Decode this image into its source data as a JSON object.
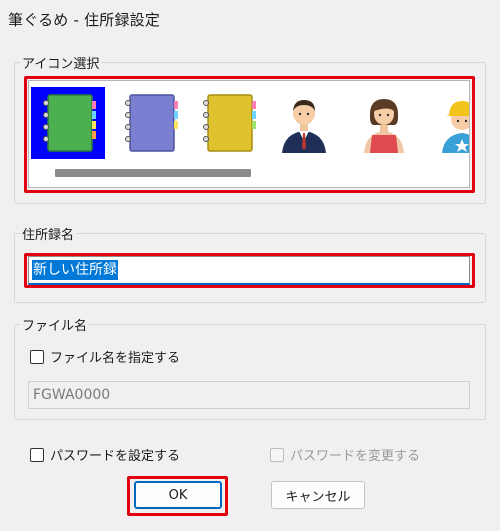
{
  "window": {
    "title": "筆ぐるめ - 住所録設定"
  },
  "icon_section": {
    "label": "アイコン選択",
    "icons": [
      {
        "name": "green-notebook-icon",
        "color": "#4caf50",
        "selected": true
      },
      {
        "name": "purple-notebook-icon",
        "color": "#7b7fd1",
        "selected": false
      },
      {
        "name": "yellow-notebook-icon",
        "color": "#e0c22e",
        "selected": false
      },
      {
        "name": "businessman-icon",
        "selected": false
      },
      {
        "name": "woman-apron-icon",
        "selected": false
      },
      {
        "name": "child-helmet-icon",
        "selected": false
      }
    ]
  },
  "address_book": {
    "label": "住所録名",
    "value": "新しい住所録"
  },
  "file_section": {
    "label": "ファイル名",
    "specify_checkbox": {
      "label": "ファイル名を指定する",
      "checked": false
    },
    "filename_value": "FGWA0000"
  },
  "password": {
    "set_label": "パスワードを設定する",
    "set_checked": false,
    "change_label": "パスワードを変更する",
    "change_checked": false,
    "change_enabled": false
  },
  "buttons": {
    "ok": "OK",
    "cancel": "キャンセル"
  },
  "colors": {
    "highlight": "#e0000f",
    "selection": "#0000ff",
    "focus": "#0067c0"
  }
}
